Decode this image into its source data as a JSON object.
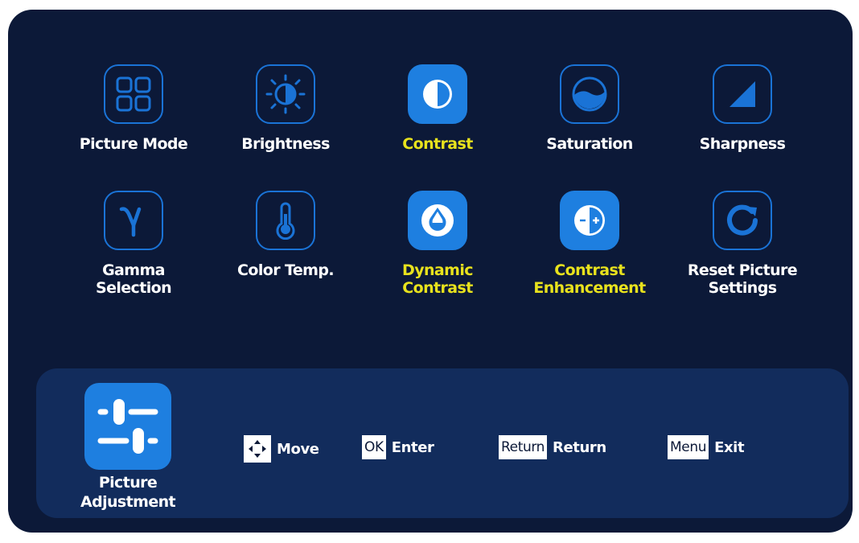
{
  "menu": {
    "items": [
      {
        "label": "Picture Mode",
        "icon": "grid-icon",
        "selected": false
      },
      {
        "label": "Brightness",
        "icon": "sun-icon",
        "selected": false
      },
      {
        "label": "Contrast",
        "icon": "contrast-icon",
        "selected": true
      },
      {
        "label": "Saturation",
        "icon": "saturation-icon",
        "selected": false
      },
      {
        "label": "Sharpness",
        "icon": "sharpness-icon",
        "selected": false
      },
      {
        "label": "Gamma\nSelection",
        "icon": "gamma-icon",
        "selected": false
      },
      {
        "label": "Color Temp.",
        "icon": "thermometer-icon",
        "selected": false
      },
      {
        "label": "Dynamic\nContrast",
        "icon": "water-drop-icon",
        "selected": true
      },
      {
        "label": "Contrast\nEnhancement",
        "icon": "contrast-plus-minus-icon",
        "selected": true
      },
      {
        "label": "Reset Picture\nSettings",
        "icon": "reset-icon",
        "selected": false
      }
    ]
  },
  "footer": {
    "section_label": "Picture\nAdjustment",
    "section_icon": "sliders-icon",
    "hints": [
      {
        "key": "",
        "key_icon": "arrows-icon",
        "action": "Move"
      },
      {
        "key": "OK",
        "action": "Enter"
      },
      {
        "key": "Return",
        "action": "Return"
      },
      {
        "key": "Menu",
        "action": "Exit"
      }
    ]
  },
  "colors": {
    "panel_bg": "#0c1938",
    "footer_bg": "#122c5c",
    "accent_blue": "#1e7fe0",
    "selected_text": "#e8e21d",
    "text": "#ffffff"
  }
}
